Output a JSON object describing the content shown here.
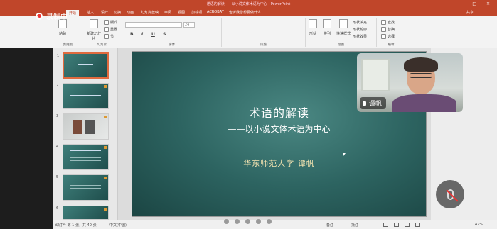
{
  "window": {
    "title": "述语的解读——以小说文体术语为中心 - PowerPoint",
    "controls": "— □ ✕"
  },
  "recording": {
    "label": "录制中"
  },
  "ribbon_tabs": [
    {
      "label": "开始",
      "active": true
    },
    {
      "label": "插入"
    },
    {
      "label": "设计"
    },
    {
      "label": "切换"
    },
    {
      "label": "动画"
    },
    {
      "label": "幻灯片放映"
    },
    {
      "label": "审阅"
    },
    {
      "label": "视图"
    },
    {
      "label": "加载项"
    },
    {
      "label": "ACROBAT"
    },
    {
      "label": "告诉我您想要做什么..."
    }
  ],
  "share_label": "共享",
  "ribbon": {
    "clipboard": {
      "paste": "粘贴",
      "label": "剪贴板"
    },
    "slides": {
      "new_slide": "新建幻灯片",
      "layout": "版式",
      "reset": "重置",
      "section": "节",
      "label": "幻灯片"
    },
    "font": {
      "size": "24",
      "label": "字体"
    },
    "paragraph": {
      "label": "段落"
    },
    "drawing": {
      "shape_fill": "形状填充",
      "shape_outline": "形状轮廓",
      "shape_effects": "形状效果",
      "shape": "形状",
      "arrange": "排列",
      "quick_styles": "快速样式",
      "label": "绘图"
    },
    "editing": {
      "find": "查找",
      "replace": "替换",
      "select": "选择",
      "label": "编辑"
    }
  },
  "thumbnails": [
    "1",
    "2",
    "3",
    "4",
    "5",
    "6"
  ],
  "slide": {
    "title": "术语的解读",
    "subtitle": "——以小说文体术语为中心",
    "author": "华东师范大学 谭帆"
  },
  "video": {
    "name": "谭帆"
  },
  "status": {
    "slide_info": "幻灯片 第 1 张，共 40 张",
    "language": "中文(中国)",
    "notes": "备注",
    "comments": "批注",
    "zoom": "47%"
  },
  "colors": {
    "accent": "#c0462a",
    "slide_bg": "#2d6461",
    "author_text": "#f3e3b0"
  }
}
